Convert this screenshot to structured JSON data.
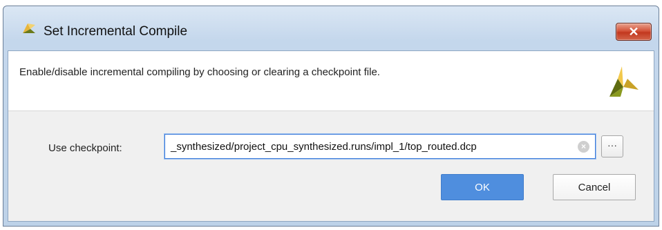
{
  "window": {
    "title": "Set Incremental Compile",
    "close_label": "✕",
    "logo_icon": "xilinx-vivado-logo-icon"
  },
  "banner": {
    "description": "Enable/disable incremental compiling by choosing or clearing a checkpoint file.",
    "logo_icon": "xilinx-vivado-logo-icon"
  },
  "checkpoint": {
    "label": "Use checkpoint:",
    "value": "_synthesized/project_cpu_synthesized.runs/impl_1/top_routed.dcp",
    "clear_icon": "clear-icon",
    "browse_label": "···"
  },
  "buttons": {
    "ok_label": "OK",
    "cancel_label": "Cancel"
  },
  "colors": {
    "accent": "#4f8ede",
    "logo_dark": "#5e6b10",
    "logo_light": "#f2c84b"
  }
}
